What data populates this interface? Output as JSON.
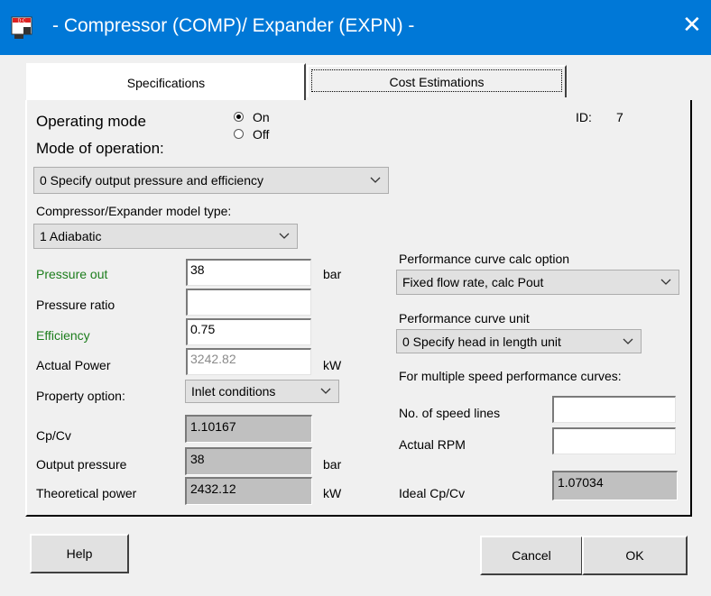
{
  "window": {
    "title": "- Compressor (COMP)/ Expander (EXPN) -",
    "close_symbol": "✕",
    "accent": "#0078d7"
  },
  "tabs": [
    {
      "label": "Specifications"
    },
    {
      "label": "Cost Estimations"
    }
  ],
  "form": {
    "operating_mode_label": "Operating mode",
    "radio_on": "On",
    "radio_off": "Off",
    "id_label": "ID:",
    "id_value": "7",
    "mode_label": "Mode of operation:",
    "mode_value": "0 Specify output pressure and efficiency",
    "model_type_label": "Compressor/Expander model type:",
    "model_type_value": "1 Adiabatic",
    "pressure_out_label": "Pressure out",
    "pressure_out_value": "38",
    "pressure_out_unit": "bar",
    "pressure_ratio_label": "Pressure ratio",
    "pressure_ratio_value": "",
    "efficiency_label": "Efficiency",
    "efficiency_value": "0.75",
    "actual_power_label": "Actual Power",
    "actual_power_value": "3242.82",
    "actual_power_unit": "kW",
    "property_option_label": "Property option:",
    "property_option_value": "Inlet conditions",
    "cpcv_label": "Cp/Cv",
    "cpcv_value": "1.10167",
    "output_pressure_label": "Output pressure",
    "output_pressure_value": "38",
    "output_pressure_unit": "bar",
    "theoretical_power_label": "Theoretical power",
    "theoretical_power_value": "2432.12",
    "theoretical_power_unit": "kW",
    "perf_calc_label": "Performance curve calc option",
    "perf_calc_value": "Fixed flow rate, calc Pout",
    "perf_unit_label": "Performance curve unit",
    "perf_unit_value": "0  Specify head in length unit",
    "multi_speed_label": "For multiple speed performance curves:",
    "speed_lines_label": "No. of speed lines",
    "speed_lines_value": "",
    "actual_rpm_label": "Actual RPM",
    "actual_rpm_value": "",
    "ideal_cpcv_label": "Ideal Cp/Cv",
    "ideal_cpcv_value": "1.07034",
    "green_label_color": "#1c7d1c"
  },
  "buttons": {
    "help": "Help",
    "cancel": "Cancel",
    "ok": "OK"
  },
  "icons": {
    "app": "app-icon",
    "close": "close-icon",
    "dropdown": "chevron-down-icon"
  }
}
